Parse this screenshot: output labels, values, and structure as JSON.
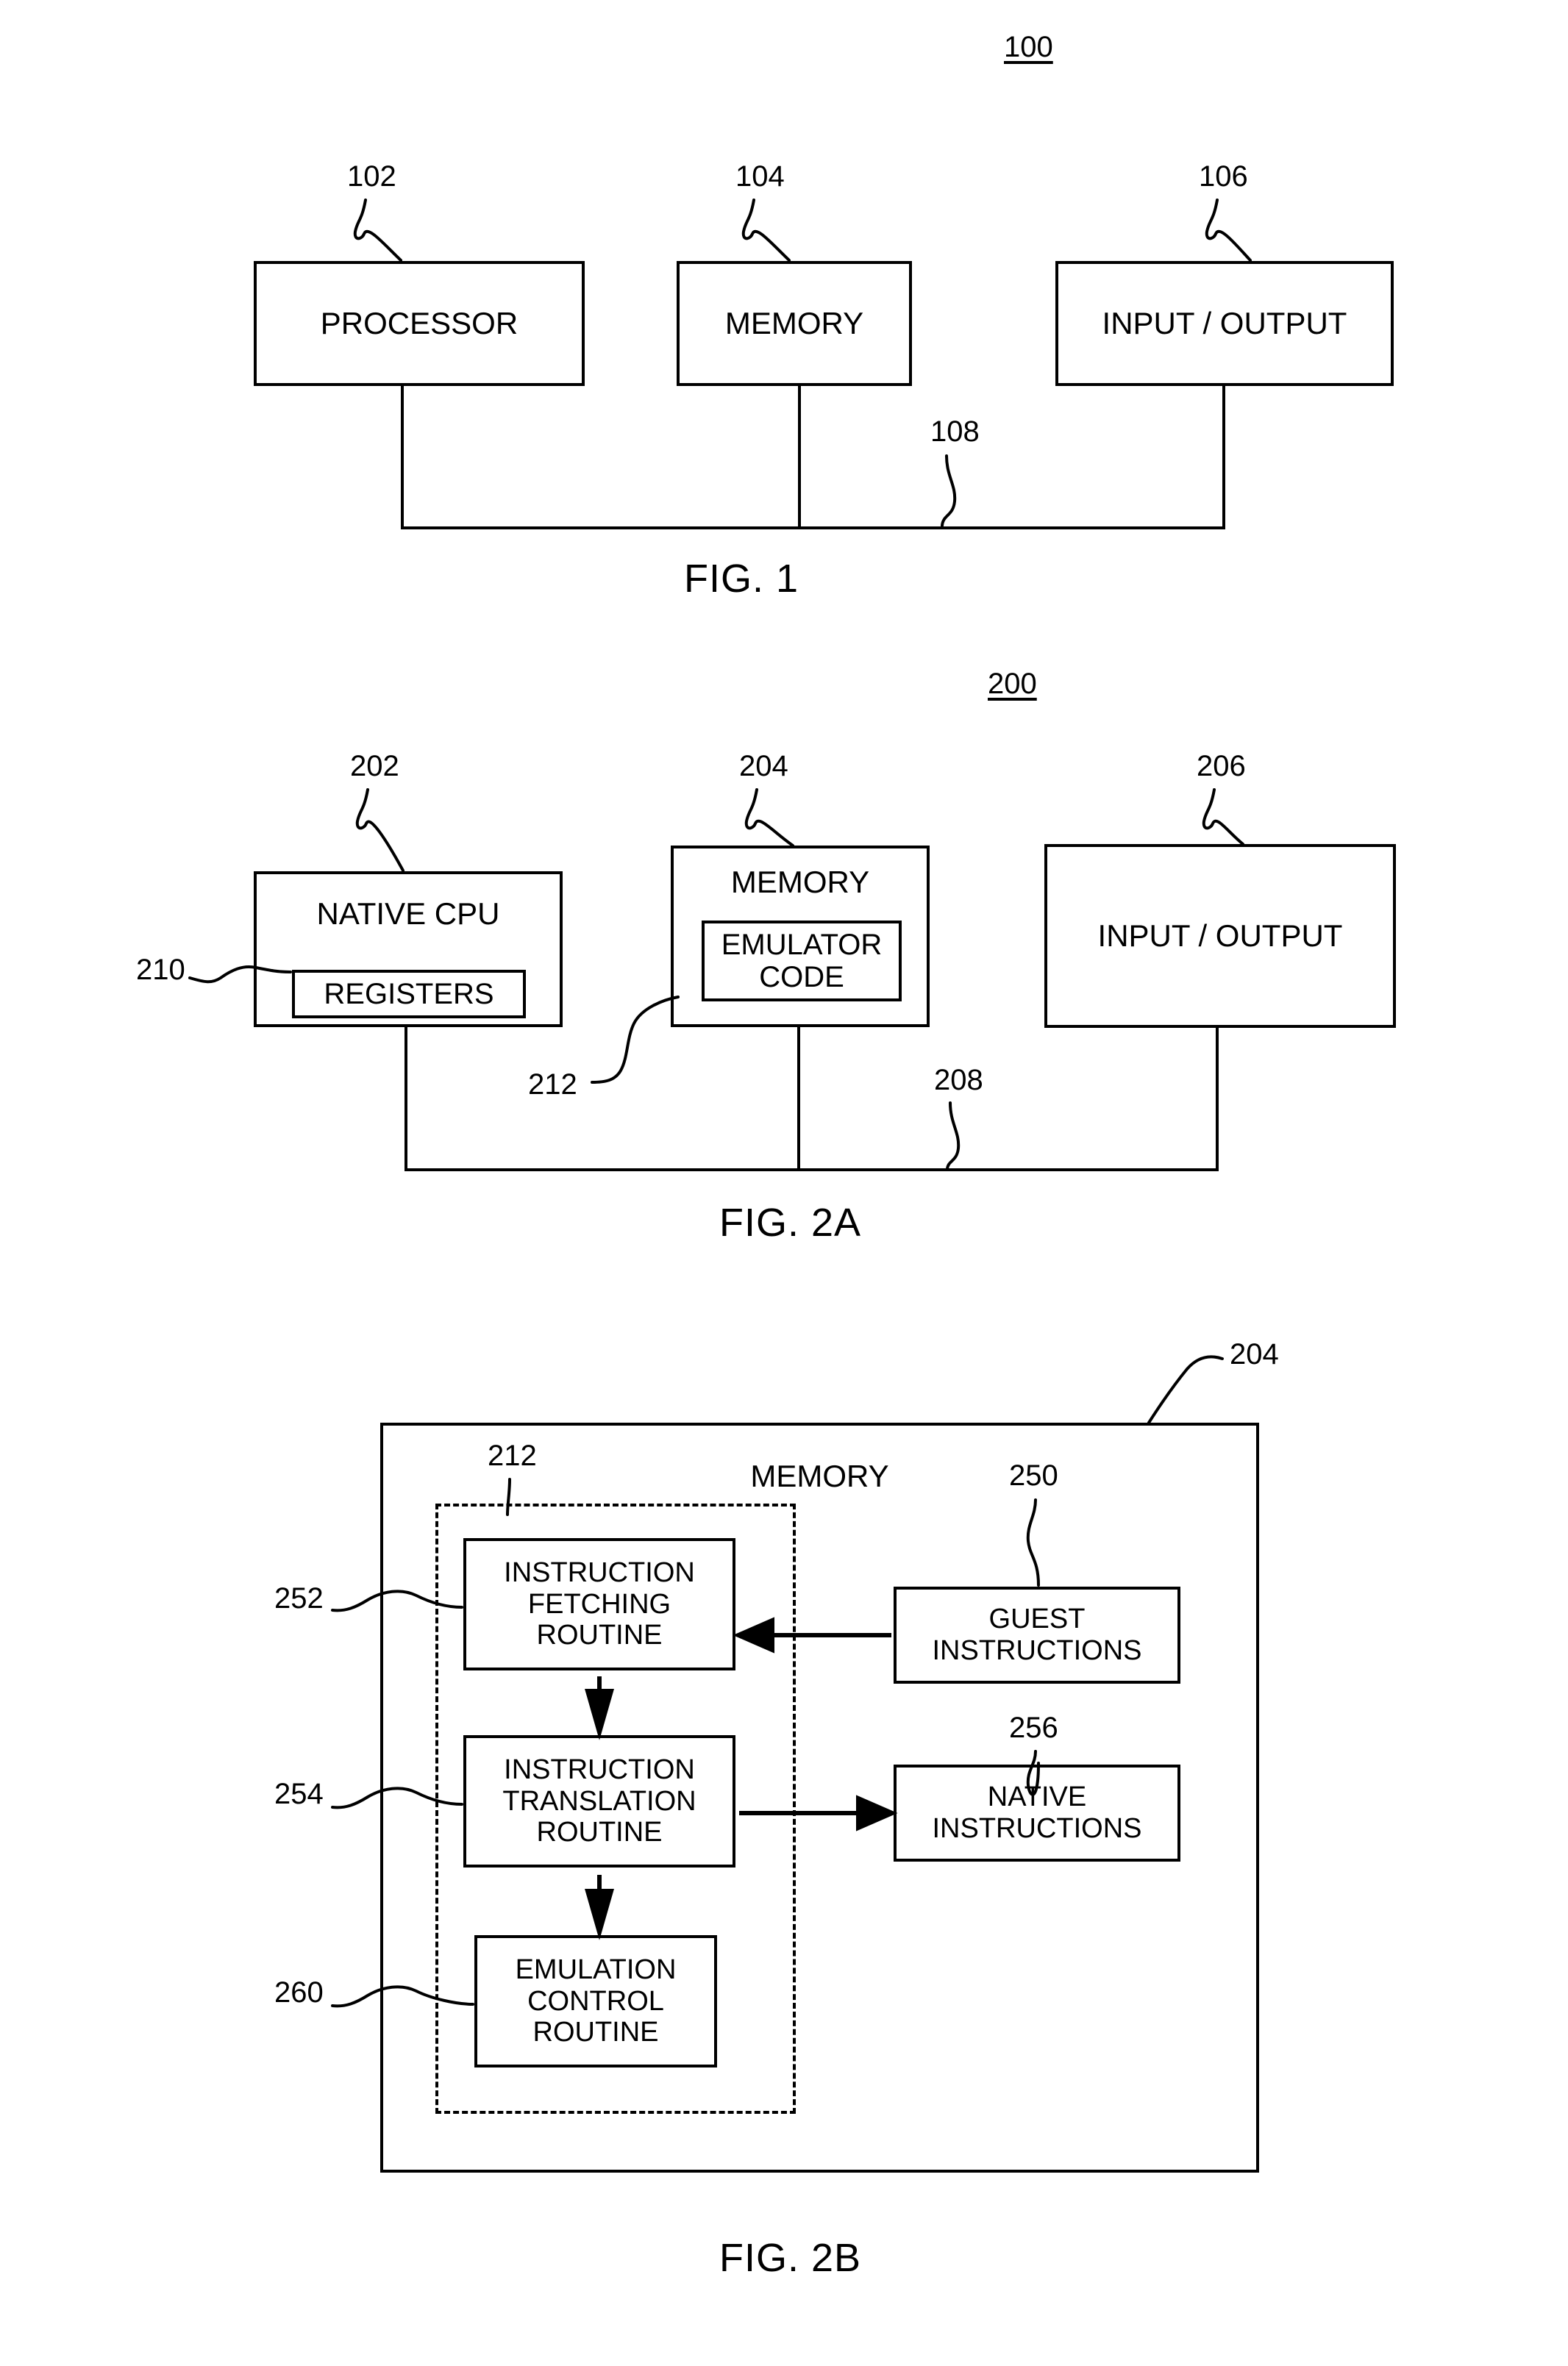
{
  "figures": [
    {
      "id": "fig1",
      "caption": "FIG. 1",
      "assembly_ref": "100",
      "blocks": [
        {
          "label": "PROCESSOR",
          "ref": "102"
        },
        {
          "label": "MEMORY",
          "ref": "104"
        },
        {
          "label": "INPUT / OUTPUT",
          "ref": "106"
        }
      ],
      "bus_ref": "108"
    },
    {
      "id": "fig2a",
      "caption": "FIG. 2A",
      "assembly_ref": "200",
      "blocks": [
        {
          "label": "NATIVE CPU",
          "ref": "202",
          "inner": {
            "label": "REGISTERS",
            "ref": "210"
          }
        },
        {
          "label": "MEMORY",
          "ref": "204",
          "inner": {
            "label_line1": "EMULATOR",
            "label_line2": "CODE",
            "ref": "212"
          }
        },
        {
          "label": "INPUT / OUTPUT",
          "ref": "206"
        }
      ],
      "bus_ref": "208"
    },
    {
      "id": "fig2b",
      "caption": "FIG. 2B",
      "container": {
        "label": "MEMORY",
        "ref": "204"
      },
      "group": {
        "ref": "212"
      },
      "routines": [
        {
          "ref": "252",
          "line1": "INSTRUCTION",
          "line2": "FETCHING",
          "line3": "ROUTINE"
        },
        {
          "ref": "254",
          "line1": "INSTRUCTION",
          "line2": "TRANSLATION",
          "line3": "ROUTINE"
        },
        {
          "ref": "260",
          "line1": "EMULATION",
          "line2": "CONTROL",
          "line3": "ROUTINE"
        }
      ],
      "side_blocks": [
        {
          "ref": "250",
          "line1": "GUEST",
          "line2": "INSTRUCTIONS"
        },
        {
          "ref": "256",
          "line1": "NATIVE",
          "line2": "INSTRUCTIONS"
        }
      ]
    }
  ],
  "colors": {
    "ink": "#000000",
    "paper": "#ffffff"
  }
}
